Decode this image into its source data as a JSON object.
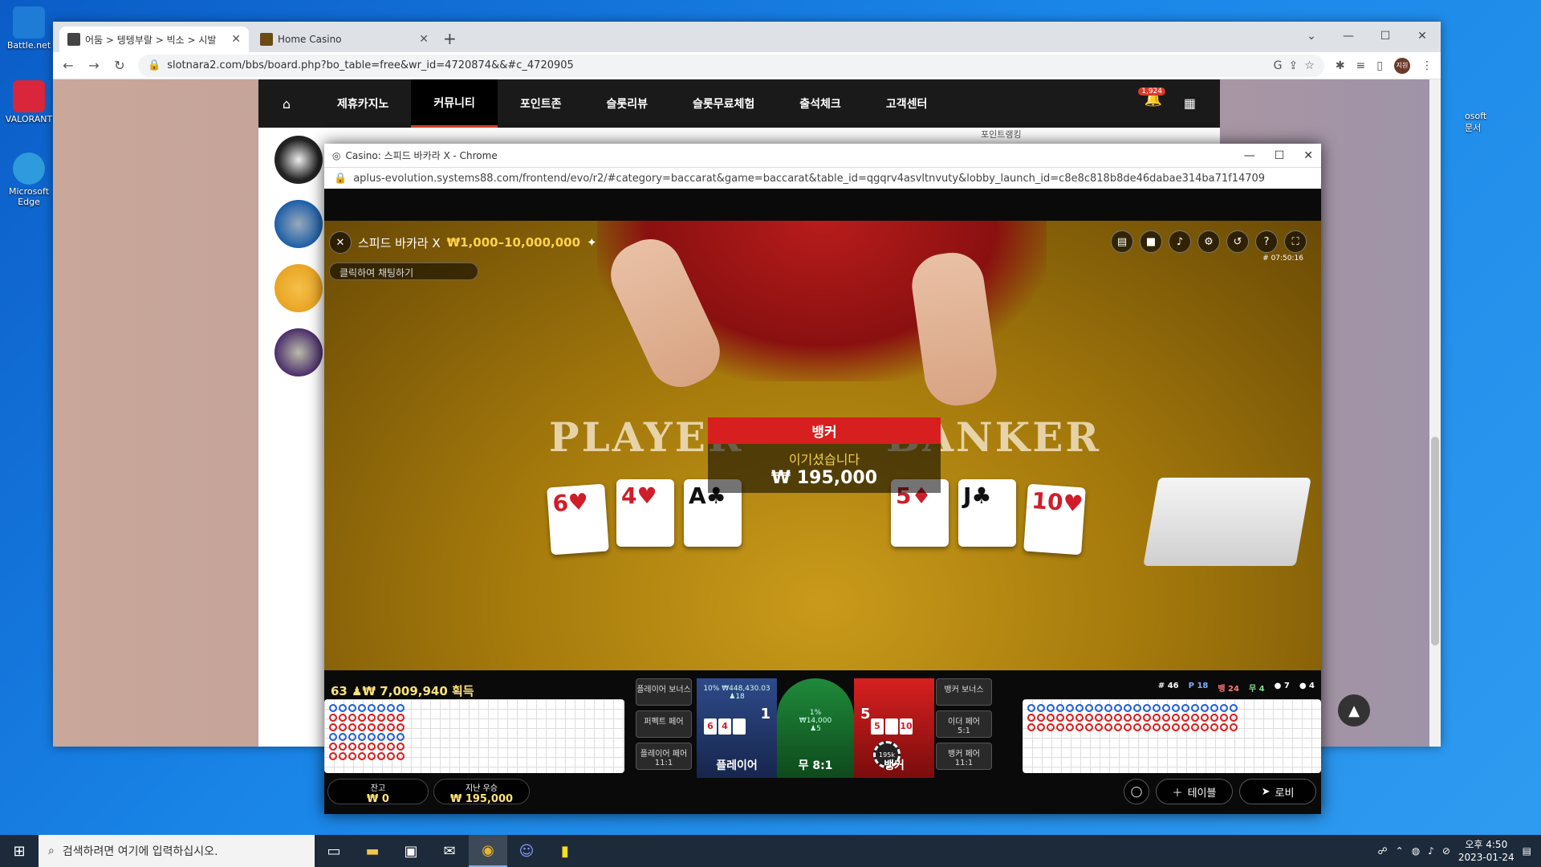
{
  "desktop": {
    "icons": [
      {
        "label": "Battle.net",
        "color": "#1f7cd6"
      },
      {
        "label": "VALORANT",
        "color": "#d9263a"
      },
      {
        "label": "Microsoft Edge",
        "color": "#2e9bdc"
      }
    ],
    "right_label": "osoft\n문서"
  },
  "browser": {
    "tabs": [
      {
        "title": "어둠 > 텡텡부랄 > 빅소 > 시발"
      },
      {
        "title": "Home Casino"
      }
    ],
    "url": "slotnara2.com/bbs/board.php?bo_table=free&wr_id=4720874&&#c_4720905",
    "profile": "지원"
  },
  "site": {
    "nav": [
      "제휴카지노",
      "커뮤니티",
      "포인트존",
      "슬롯리뷰",
      "슬롯무료체험",
      "출석체크",
      "고객센터"
    ],
    "active_nav": "커뮤니티",
    "bell_count": "1,924",
    "partial_text": "포인트랭킹",
    "counter": "924"
  },
  "popup": {
    "title": "Casino: 스피드 바카라 X - Chrome",
    "url": "aplus-evolution.systems88.com/frontend/evo/r2/#category=baccarat&game=baccarat&table_id=qgqrv4asvltnvuty&lobby_launch_id=c8e8c818b8de46dabae314ba71f14709"
  },
  "game": {
    "table_name": "스피드 바카라 X",
    "limits": "₩1,000–10,000,000",
    "chat_placeholder": "클릭하여 채팅하기",
    "timecode": "# 07:50:16",
    "felt_player": "PLAYER",
    "felt_banker": "BANKER",
    "win_side": "뱅커",
    "win_msg": "이기셨습니다",
    "win_amount": "₩ 195,000",
    "player_cards": [
      {
        "rank": "6",
        "suit": "♥",
        "color": "red"
      },
      {
        "rank": "4",
        "suit": "♥",
        "color": "red"
      },
      {
        "rank": "A",
        "suit": "♣",
        "color": "black"
      }
    ],
    "banker_cards": [
      {
        "rank": "5",
        "suit": "♦",
        "color": "red"
      },
      {
        "rank": "J",
        "suit": "♣",
        "color": "black"
      },
      {
        "rank": "10",
        "suit": "♥",
        "color": "red"
      }
    ],
    "winners": "63 ♟₩ 7,009,940 획득",
    "side_bets": {
      "player_bonus": "플레이어 보너스",
      "perfect_pair": "퍼펙트 페어",
      "player_pair": "플레이어 페어",
      "player_pair_odds": "11:1",
      "banker_bonus": "뱅커 보너스",
      "either_pair": "이더 페어",
      "either_pair_odds": "5:1",
      "banker_pair": "뱅커 페어",
      "banker_pair_odds": "11:1"
    },
    "player_zone": {
      "name": "플레이어",
      "score": "1",
      "amount": "₩448,430.03",
      "pct": "10%",
      "players": "18"
    },
    "tie_zone": {
      "name": "무 8:1",
      "amount": "₩14,000",
      "pct": "1%",
      "players": "5"
    },
    "banker_zone": {
      "name": "뱅커",
      "score": "5",
      "chip": "195k"
    },
    "stats": {
      "rounds": "# 46",
      "player": "18",
      "banker": "24",
      "tie": "4",
      "p_pair": "7",
      "b_pair": "4"
    },
    "balance_label": "잔고",
    "balance_value": "₩ 0",
    "last_win_label": "지난 우승",
    "last_win_value": "₩ 195,000",
    "table_btn": "테이블",
    "lobby_btn": "로비"
  },
  "taskbar": {
    "search_placeholder": "검색하려면 여기에 입력하십시오.",
    "time": "오후 4:50",
    "date": "2023-01-24"
  }
}
